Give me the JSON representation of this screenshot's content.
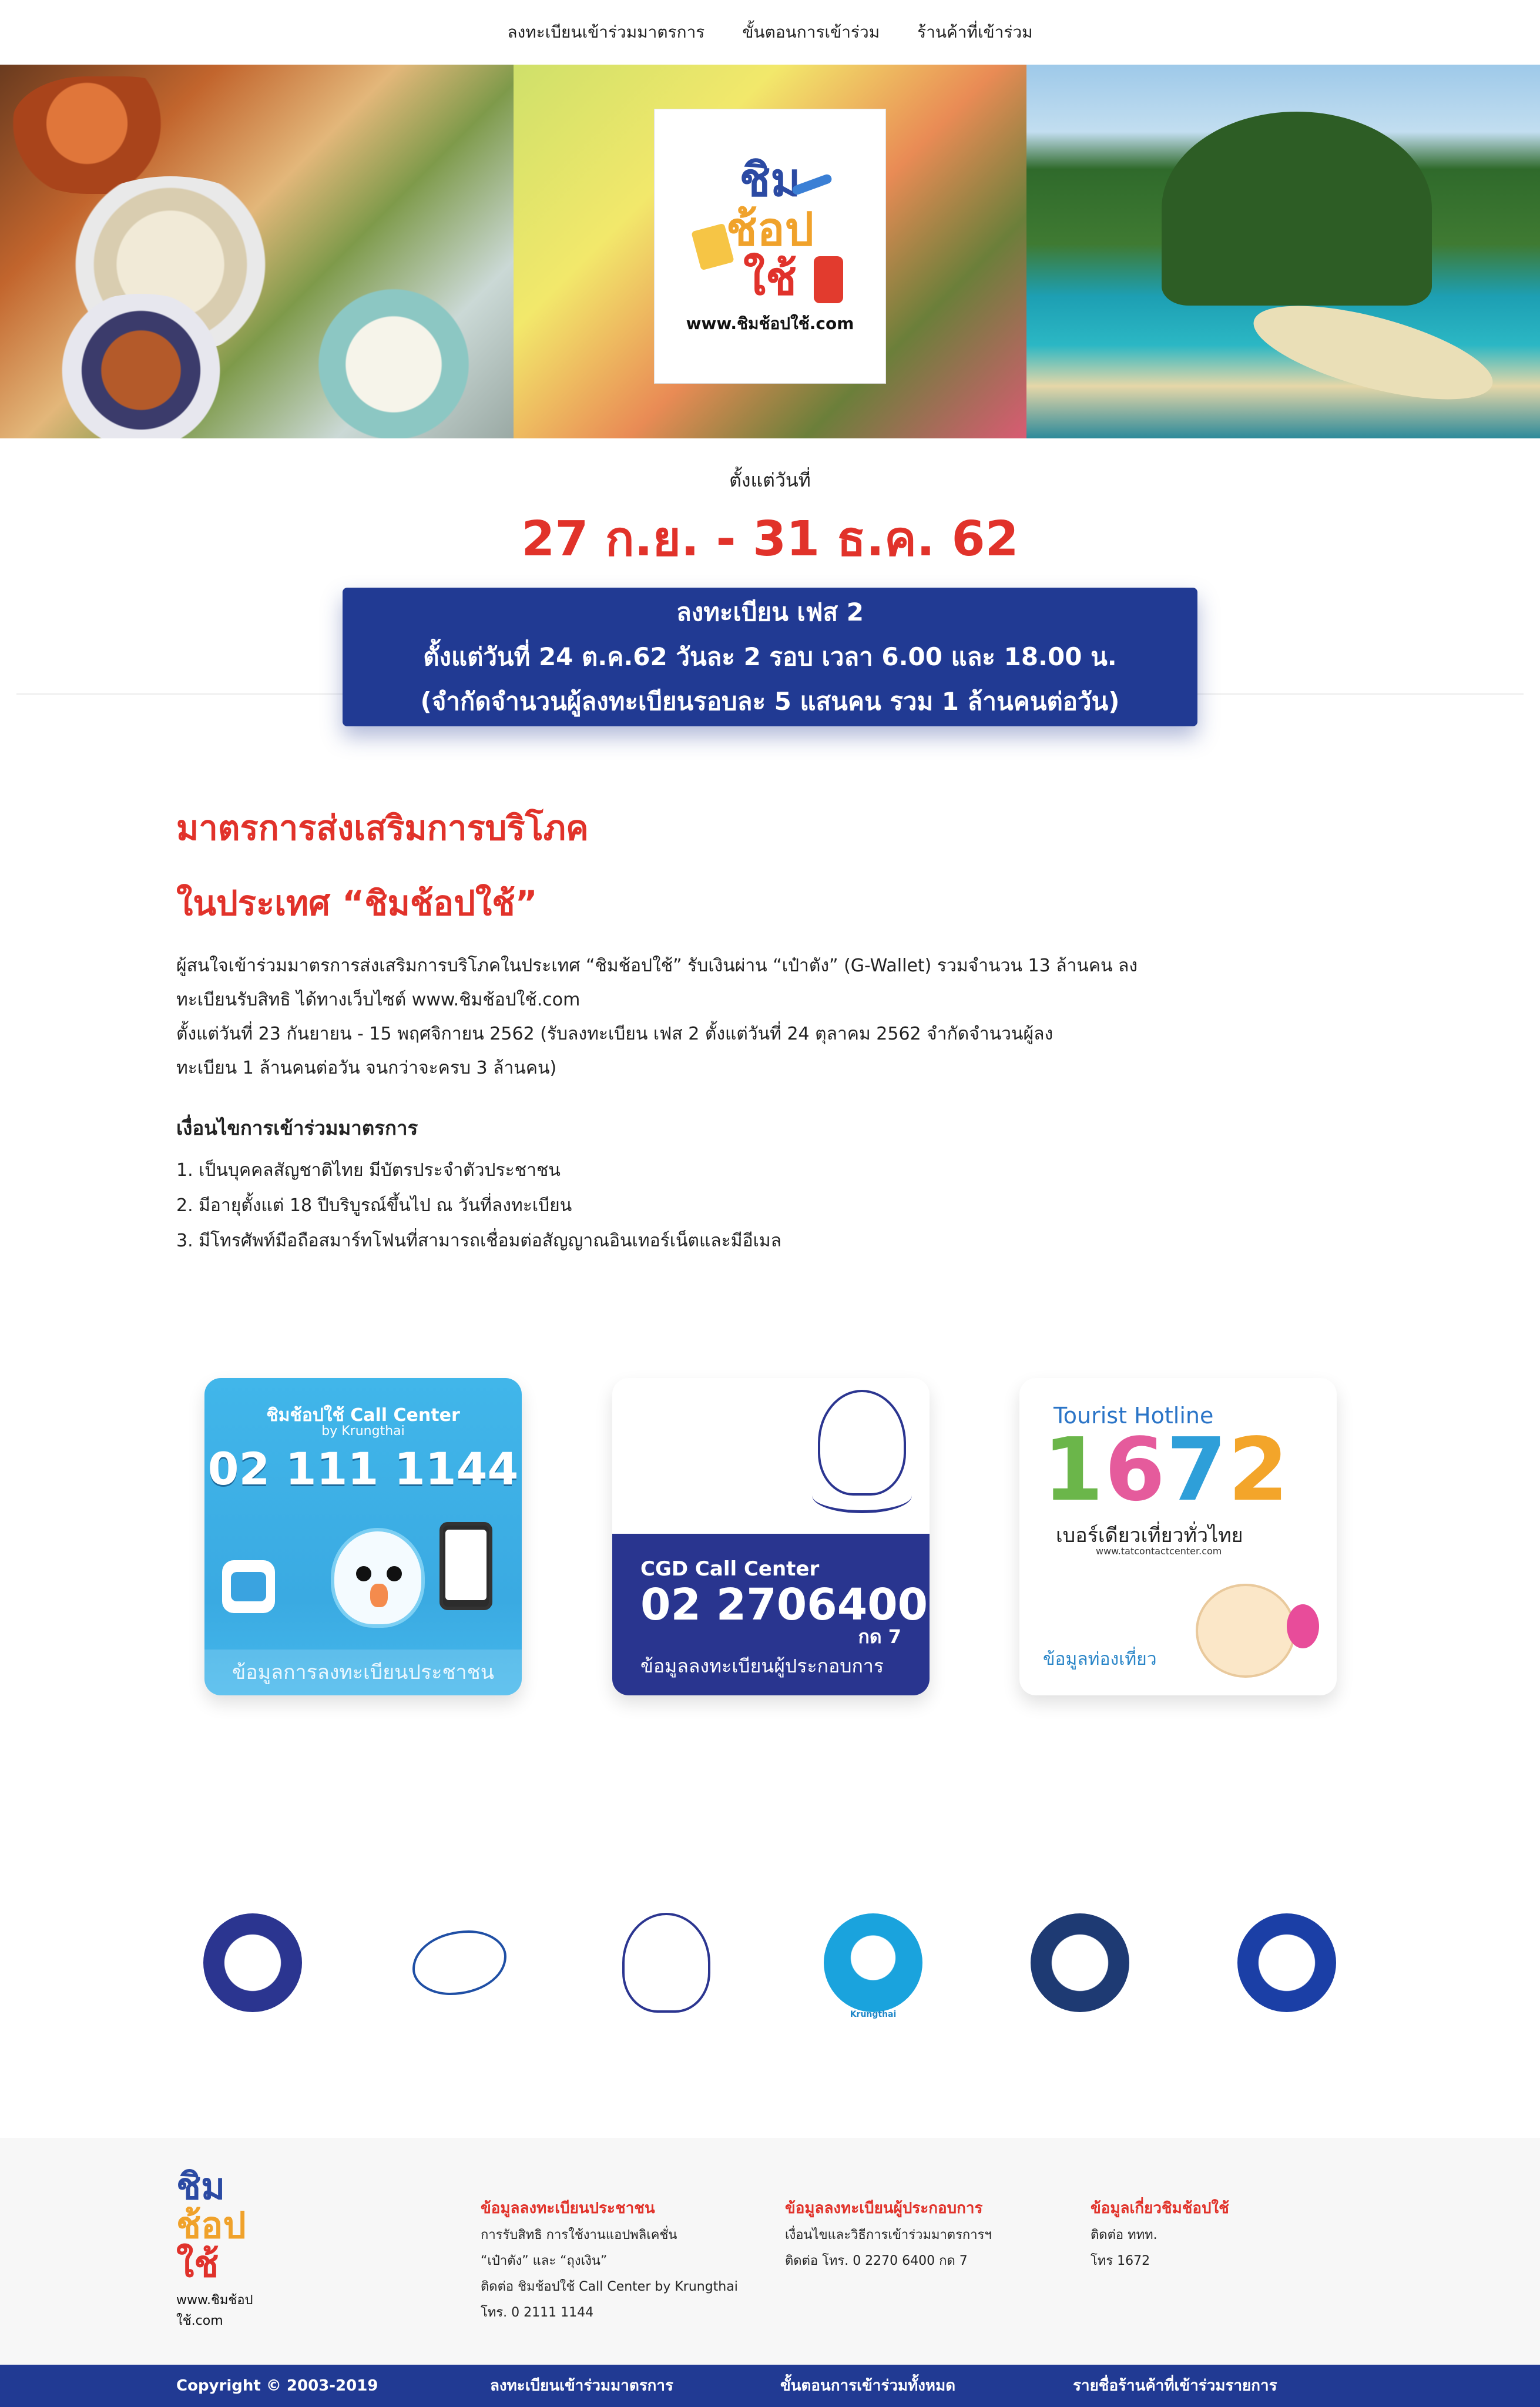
{
  "nav": {
    "items": [
      {
        "label": "ลงทะเบียนเข้าร่วมมาตรการ"
      },
      {
        "label": "ขั้นตอนการเข้าร่วม"
      },
      {
        "label": "ร้านค้าที่เข้าร่วม"
      }
    ]
  },
  "hero": {
    "logo": {
      "line1": "ชิม",
      "line2": "ช้อป",
      "line3": "ใช้",
      "url": "www.ชิมช้อปใช้.com"
    }
  },
  "dates": {
    "since_label": "ตั้งแต่วันที่",
    "range": "27 ก.ย. - 31 ธ.ค. 62"
  },
  "phase_banner": {
    "line1": "ลงทะเบียน เฟส 2",
    "line2": "ตั้งแต่วันที่ 24 ต.ค.62 วันละ 2 รอบ เวลา 6.00 และ 18.00 น.",
    "line3": "(จำกัดจำนวนผู้ลงทะเบียนรอบละ 5 แสนคน รวม 1 ล้านคนต่อวัน)"
  },
  "main": {
    "heading_line1": "มาตรการส่งเสริมการบริโภค",
    "heading_line2": "ในประเทศ “ชิมช้อปใช้”",
    "para_line1": "ผู้สนใจเข้าร่วมมาตรการส่งเสริมการบริโภคในประเทศ “ชิมช้อปใช้” รับเงินผ่าน “เป๋าตัง” (G-Wallet) รวมจำนวน 13 ล้านคน ลง",
    "para_line2": "ทะเบียนรับสิทธิ ได้ทางเว็บไซต์ www.ชิมช้อปใช้.com",
    "para_line3": "ตั้งแต่วันที่ 23 กันยายน - 15 พฤศจิกายน 2562 (รับลงทะเบียน เฟส 2 ตั้งแต่วันที่ 24 ตุลาคม 2562 จำกัดจำนวนผู้ลง",
    "para_line4": "ทะเบียน 1 ล้านคนต่อวัน จนกว่าจะครบ 3 ล้านคน)",
    "conditions_heading": "เงื่อนไขการเข้าร่วมมาตรการ",
    "conditions": [
      "1. เป็นบุคคลสัญชาติไทย มีบัตรประจำตัวประชาชน",
      "2. มีอายุตั้งแต่ 18 ปีบริบูรณ์ขึ้นไป ณ วันที่ลงทะเบียน",
      "3. มีโทรศัพท์มือถือสมาร์ทโฟนที่สามารถเชื่อมต่อสัญญาณอินเทอร์เน็ตและมีอีเมล"
    ]
  },
  "cards": {
    "ktb": {
      "title": "ชิมช้อปใช้ Call Center",
      "subtitle": "by Krungthai",
      "phone": "02 111 1144",
      "footer": "ข้อมูลการลงทะเบียนประชาชน"
    },
    "cgd": {
      "title": "CGD Call Center",
      "phone": "02 2706400",
      "ext": "กด 7",
      "footer": "ข้อมูลลงทะเบียนผู้ประกอบการ"
    },
    "tat": {
      "title": "Tourist Hotline",
      "digit1": "1",
      "digit2": "6",
      "digit3": "7",
      "digit4": "2",
      "tagline": "เบอร์เดียวเที่ยวทั่วไทย",
      "url": "www.tatcontactcenter.com",
      "footer": "ข้อมูลท่องเที่ยว"
    }
  },
  "partners": {
    "ktb_caption": "Krungthai"
  },
  "footer": {
    "logo_url": "www.ชิมช้อปใช้.com",
    "col1": {
      "heading": "ข้อมูลลงทะเบียนประชาชน",
      "lines": [
        "การรับสิทธิ การใช้งานแอปพลิเคชั่น",
        "“เป๋าตัง” และ “ถุงเงิน”",
        "ติดต่อ ชิมช้อปใช้ Call Center by Krungthai",
        "โทร. 0 2111 1144"
      ]
    },
    "col2": {
      "heading": "ข้อมูลลงทะเบียนผู้ประกอบการ",
      "lines": [
        "เงื่อนไขและวิธีการเข้าร่วมมาตรการฯ",
        "ติดต่อ โทร. 0 2270 6400 กด 7"
      ]
    },
    "col3": {
      "heading": "ข้อมูลเกี่ยวชิมช้อปใช้",
      "lines": [
        "ติดต่อ ททท.",
        "โทร 1672"
      ]
    }
  },
  "bottombar": {
    "copyright": "Copyright © 2003-2019",
    "link1": "ลงทะเบียนเข้าร่วมมาตรการ",
    "link2": "ขั้นตอนการเข้าร่วมทั้งหมด",
    "link3": "รายชื่อร้านค้าที่เข้าร่วมรายการ"
  },
  "colors": {
    "accent_red": "#e1322a",
    "brand_blue": "#213a93",
    "ktb_blue": "#3aaae2"
  }
}
